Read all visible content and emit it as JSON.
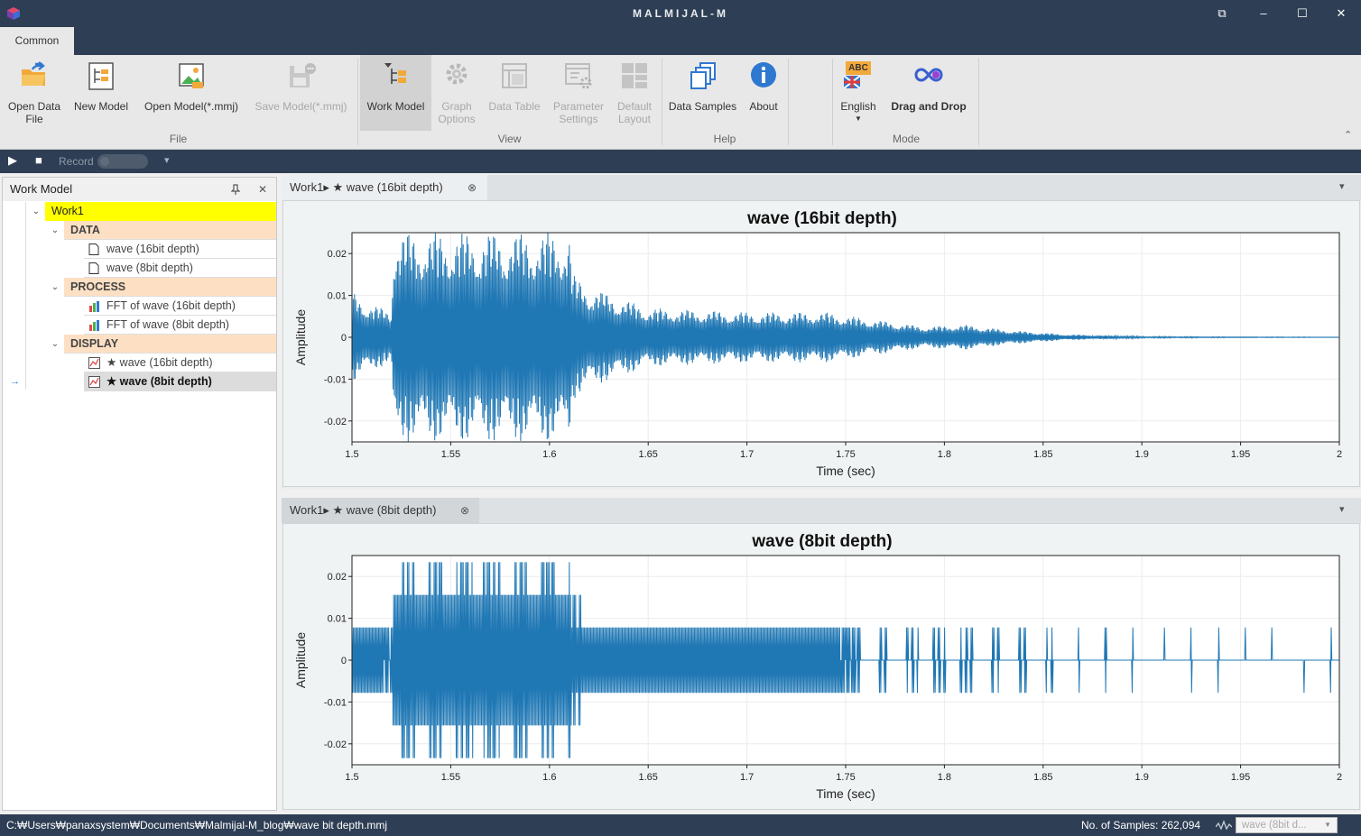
{
  "app": {
    "title": "MALMIJAL-M",
    "minimize": "–",
    "maximize": "☐",
    "close": "✕",
    "restore": "⧉"
  },
  "ribbon": {
    "tab": "Common",
    "buttons": {
      "open_data": "Open Data\nFile",
      "new_model": "New Model",
      "open_model": "Open Model(*.mmj)",
      "save_model": "Save Model(*.mmj)",
      "work_model": "Work Model",
      "graph_options": "Graph\nOptions",
      "data_table": "Data Table",
      "param_settings": "Parameter\nSettings",
      "default_layout": "Default\nLayout",
      "data_samples": "Data Samples",
      "about": "About",
      "english": "English",
      "drag_drop": "Drag and Drop"
    },
    "groups": {
      "file": "File",
      "view": "View",
      "help": "Help",
      "mode": "Mode"
    },
    "abc": "ABC",
    "collapse": "⌃"
  },
  "toolbar": {
    "record": "Record",
    "play": "▶",
    "stop": "■",
    "dropdown": "▾"
  },
  "sidebar": {
    "title": "Work Model",
    "pin": "📌",
    "close": "✕",
    "root": "Work1",
    "data": "DATA",
    "data_items": [
      "wave (16bit depth)",
      "wave (8bit depth)"
    ],
    "process": "PROCESS",
    "process_items": [
      "FFT of wave (16bit depth)",
      "FFT of wave (8bit depth)"
    ],
    "display": "DISPLAY",
    "display_items": [
      "★ wave (16bit depth)",
      "★ wave (8bit depth)"
    ],
    "arrow": "→"
  },
  "pane1": {
    "tab": "Work1▸ ★ wave (16bit depth)",
    "close": "⊗",
    "menu": "▾"
  },
  "pane2": {
    "tab": "Work1▸ ★ wave (8bit depth)",
    "close": "⊗",
    "menu": "▾"
  },
  "chart_data": [
    {
      "type": "line",
      "title": "wave (16bit depth)",
      "xlabel": "Time (sec)",
      "ylabel": "Amplitude",
      "xlim": [
        1.5,
        2.0
      ],
      "ylim": [
        -0.025,
        0.025
      ],
      "xticks": [
        "1.5",
        "1.55",
        "1.6",
        "1.65",
        "1.7",
        "1.75",
        "1.8",
        "1.85",
        "1.9",
        "1.95",
        "2"
      ],
      "yticks": [
        "0.02",
        "0.01",
        "0",
        "-0.01",
        "-0.02"
      ],
      "color": "#1f77b4",
      "grid": true,
      "envelope_x": [
        1.5,
        1.505,
        1.52,
        1.521,
        1.61,
        1.612,
        1.62,
        1.65,
        1.7,
        1.74,
        1.76,
        1.79,
        1.81,
        1.83,
        1.86,
        1.9,
        1.95,
        2.0
      ],
      "envelope_y": [
        0.011,
        0.009,
        0.006,
        0.025,
        0.025,
        0.015,
        0.012,
        0.007,
        0.006,
        0.006,
        0.0045,
        0.0025,
        0.003,
        0.0018,
        0.0007,
        0.0002,
        0.0001,
        5e-05
      ]
    },
    {
      "type": "line",
      "title": "wave (8bit depth)",
      "xlabel": "Time (sec)",
      "ylabel": "Amplitude",
      "xlim": [
        1.5,
        2.0
      ],
      "ylim": [
        -0.025,
        0.025
      ],
      "xticks": [
        "1.5",
        "1.55",
        "1.6",
        "1.65",
        "1.7",
        "1.75",
        "1.8",
        "1.85",
        "1.9",
        "1.95",
        "2"
      ],
      "yticks": [
        "0.02",
        "0.01",
        "0",
        "-0.01",
        "-0.02"
      ],
      "color": "#1f77b4",
      "grid": true,
      "quantization_step": 0.0078,
      "envelope_x": [
        1.5,
        1.505,
        1.52,
        1.521,
        1.61,
        1.612,
        1.62,
        1.65,
        1.7,
        1.74,
        1.76,
        1.79,
        1.81,
        1.83,
        1.86,
        1.9,
        1.95,
        2.0
      ],
      "envelope_y": [
        0.011,
        0.009,
        0.006,
        0.025,
        0.025,
        0.015,
        0.012,
        0.0085,
        0.0085,
        0.0085,
        0.0045,
        0.0045,
        0.0045,
        0.0045,
        0.0042,
        0.004,
        0.004,
        0.004
      ]
    }
  ],
  "status": {
    "path": "C:₩Users₩panaxsystem₩Documents₩Malmijal-M_blog₩wave bit depth.mmj",
    "samples": "No. of Samples: 262,094",
    "selector": "wave (8bit d..."
  }
}
